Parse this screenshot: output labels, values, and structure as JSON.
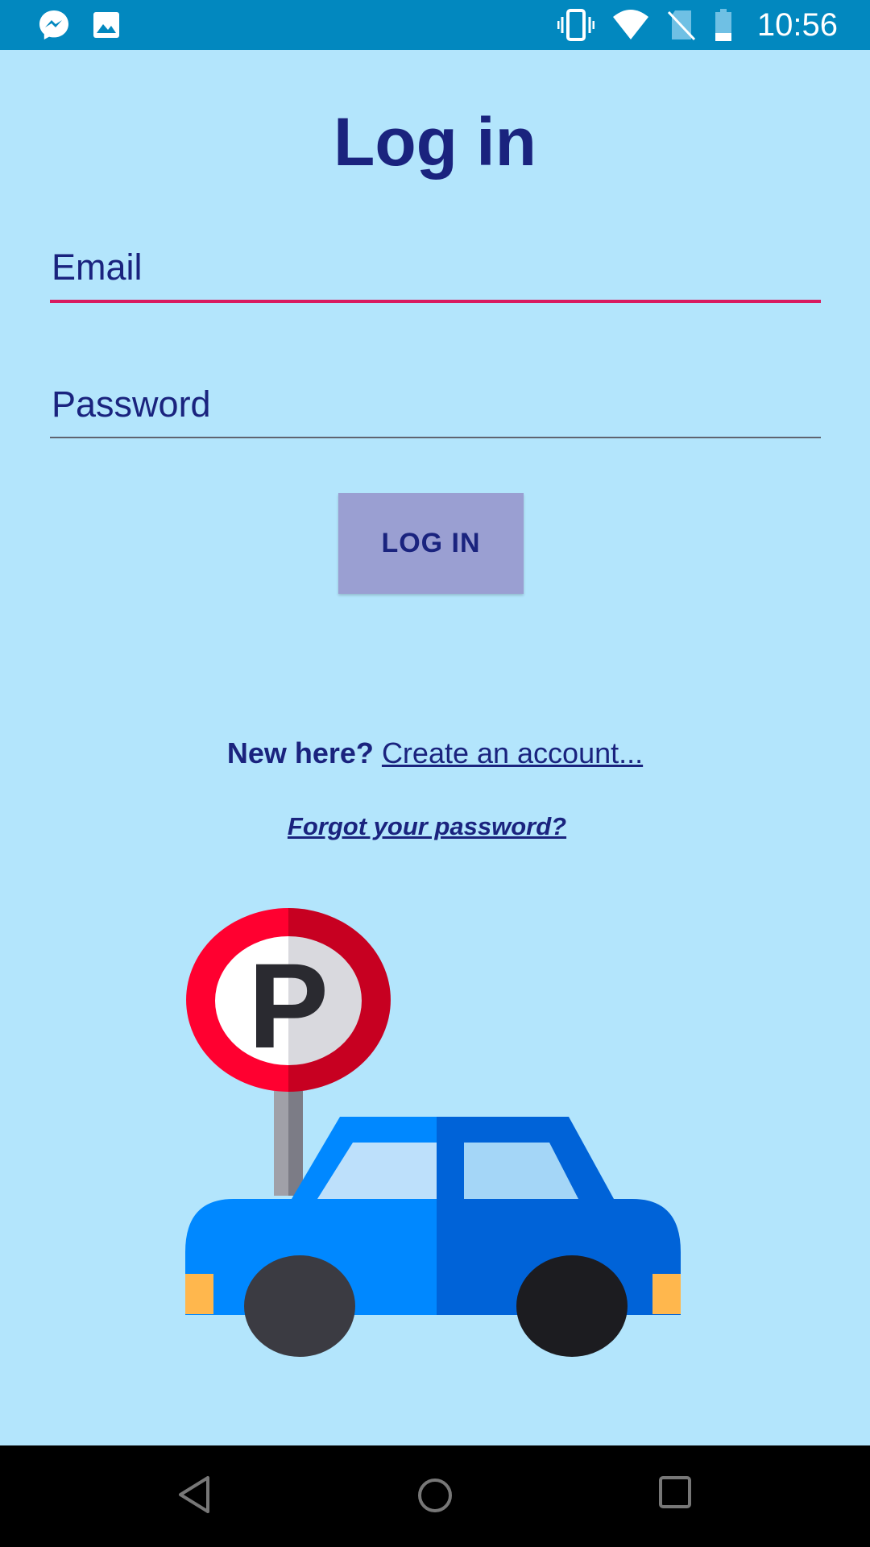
{
  "status_bar": {
    "time": "10:56",
    "icons_left": [
      "messenger-icon",
      "image-icon"
    ],
    "icons_right": [
      "vibrate-icon",
      "wifi-icon",
      "no-sim-icon",
      "battery-icon"
    ]
  },
  "title": "Log in",
  "email": {
    "placeholder": "Email",
    "value": ""
  },
  "password": {
    "placeholder": "Password",
    "value": ""
  },
  "login_button_label": "LOG IN",
  "new_here": {
    "prefix": "New here?",
    "link": "Create an account..."
  },
  "forgot_password": "Forgot your password?",
  "illustration": {
    "sign_letter": "P",
    "icon": "parking-car-illustration"
  },
  "nav_bar": {
    "buttons": [
      "back-icon",
      "home-icon",
      "recents-icon"
    ]
  },
  "colors": {
    "background": "#b3e5fc",
    "status_bar": "#0288bf",
    "text_primary": "#1a237e",
    "accent": "#d81b60",
    "button": "#9a9fd2"
  }
}
